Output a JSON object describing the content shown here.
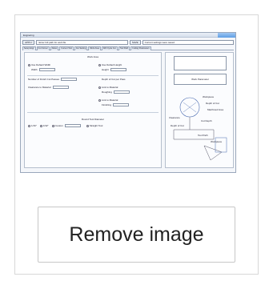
{
  "thumbnail": {
    "window_title": "Engraving",
    "toolbar": {
      "apply_label": "APPLY",
      "path_field": "Enter full path for web file",
      "save_label": "SAVE",
      "comment_field": "Current settings were saved"
    },
    "tabs": [
      "Setup Engr",
      "Cut Corner",
      "Notes",
      "Current Tool",
      "Cut Setting",
      "Work Area",
      "Drill Cycle Cut",
      "Tool Path",
      "Cutting Parameters"
    ],
    "left_panel": {
      "work_area_title": "Work Area",
      "use_default_width": "Use Default Width",
      "use_default_height": "Use Default Height",
      "width_label": "Width",
      "height_label": "Height",
      "number_finish_cut_passes": "Number of Finish Cut Passes",
      "depth_of_cut_per_pass": "Depth of Cut per Pass",
      "clearance_to_material": "Clearance to Material",
      "link_to_material": "Link to Material",
      "roughing": "Roughing",
      "finishing": "Finishing",
      "round_tool_diameter": "Round Tool Diameter",
      "size_options": [
        "1/16\"",
        "1/32\"",
        "Custom"
      ],
      "straight_tool": "Straight Tool"
    },
    "right_panel": {
      "box_label": "Work Parameter",
      "callouts": [
        "Workpiece",
        "Depth of Cut",
        "Machined Area",
        "Clearance",
        "Cut Depth",
        "Depth of Cut",
        "Tool Path",
        "Workpiece"
      ]
    }
  },
  "actions": {
    "remove_image_label": "Remove image"
  }
}
